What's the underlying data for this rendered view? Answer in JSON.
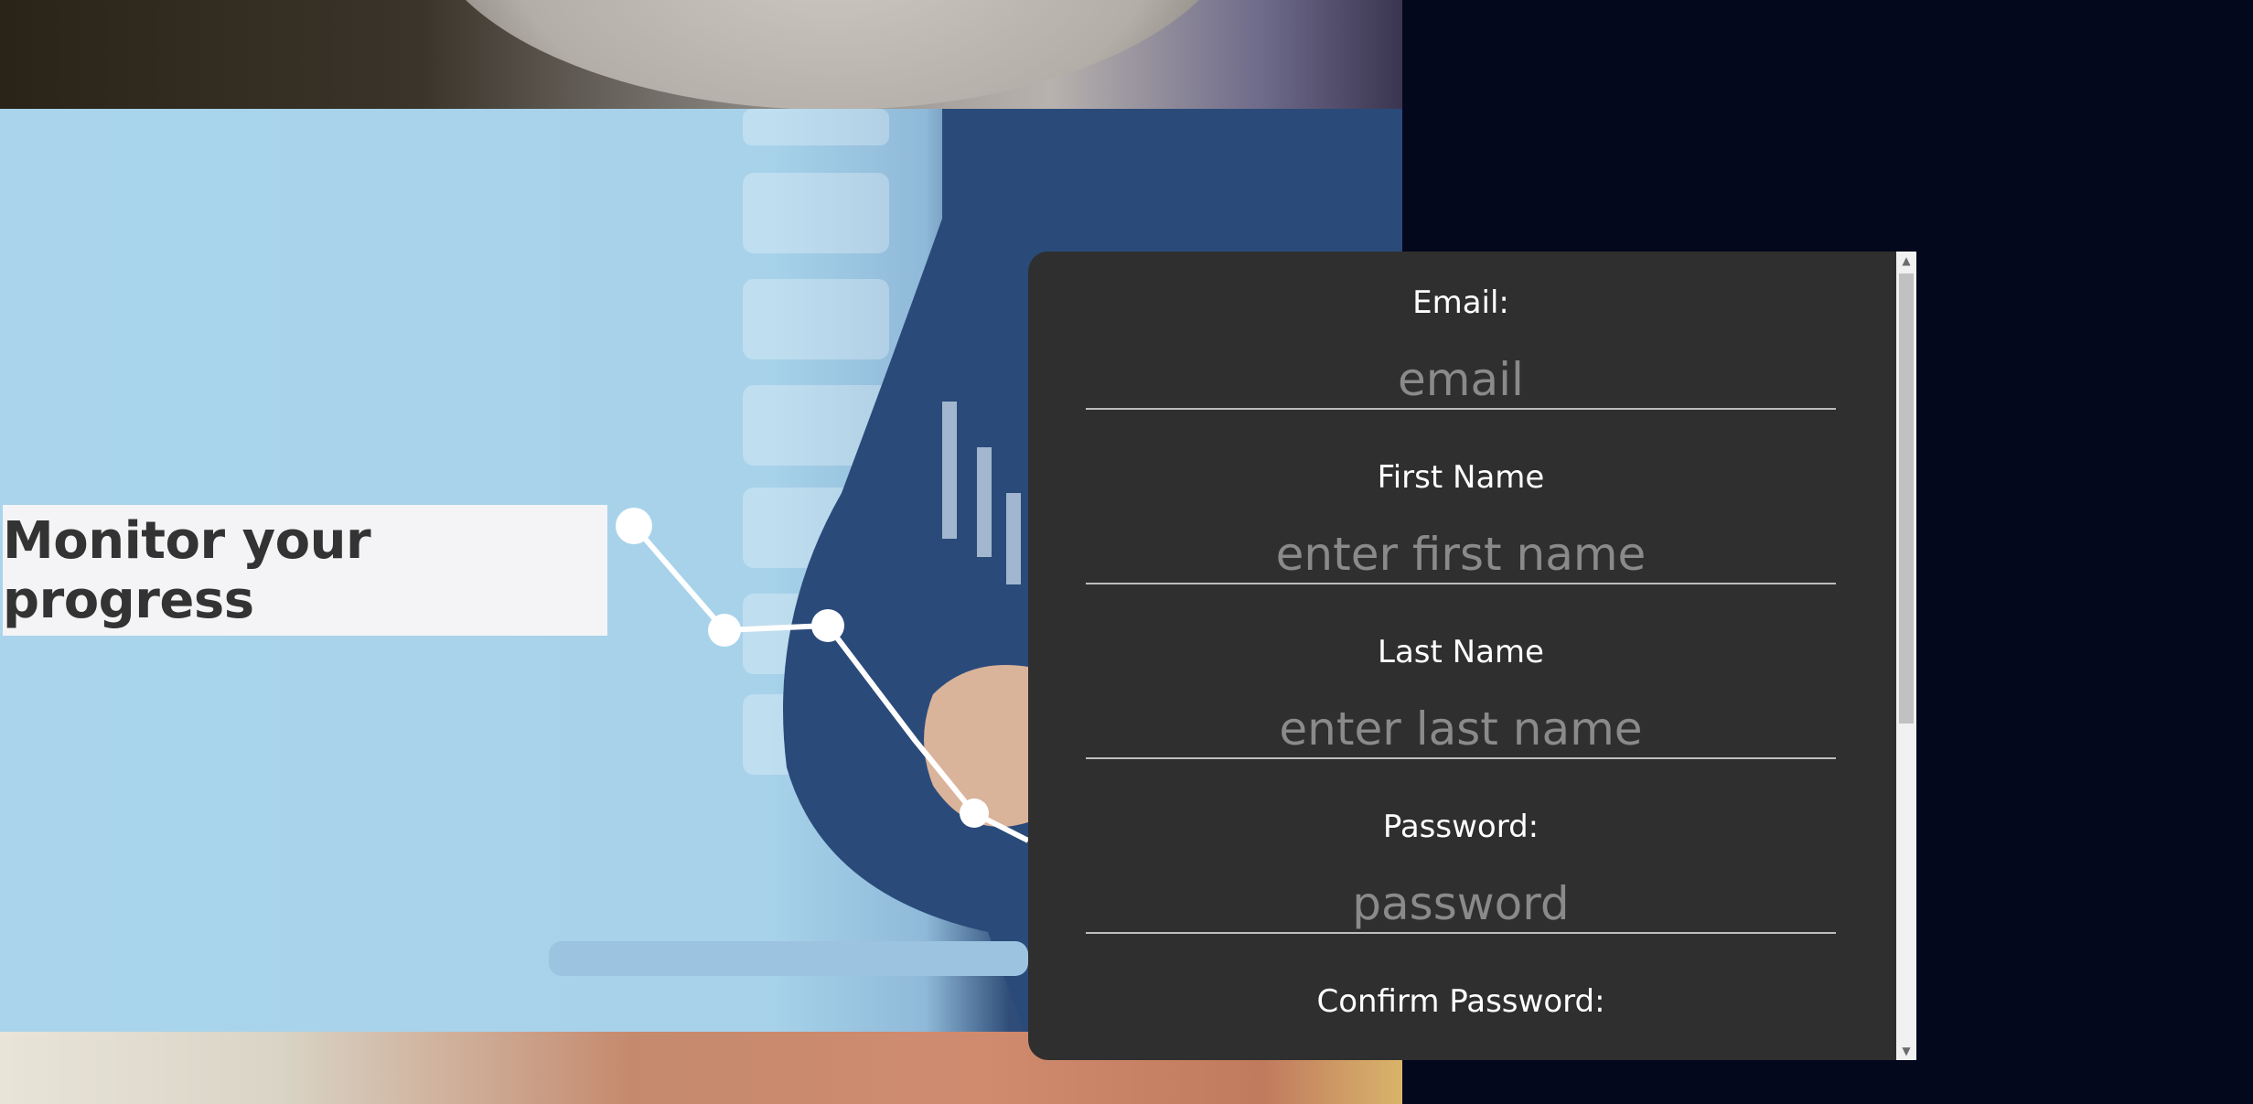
{
  "hero": {
    "headline": "Monitor your progress"
  },
  "form": {
    "fields": [
      {
        "label": "Email:",
        "placeholder": "email",
        "type": "email"
      },
      {
        "label": "First Name",
        "placeholder": "enter first name",
        "type": "text"
      },
      {
        "label": "Last Name",
        "placeholder": "enter last name",
        "type": "text"
      },
      {
        "label": "Password:",
        "placeholder": "password",
        "type": "password"
      },
      {
        "label": "Confirm Password:",
        "placeholder": "",
        "type": "password"
      }
    ]
  },
  "scrollbar": {
    "up_icon": "scroll-up-arrow-icon",
    "down_icon": "scroll-down-arrow-icon"
  },
  "colors": {
    "page_background": "#04081c",
    "panel_background": "#2f2f2f",
    "headline_background": "#f4f4f6",
    "headline_text": "#333333",
    "label_text": "#ffffff",
    "placeholder_text": "#8a8a8a"
  }
}
